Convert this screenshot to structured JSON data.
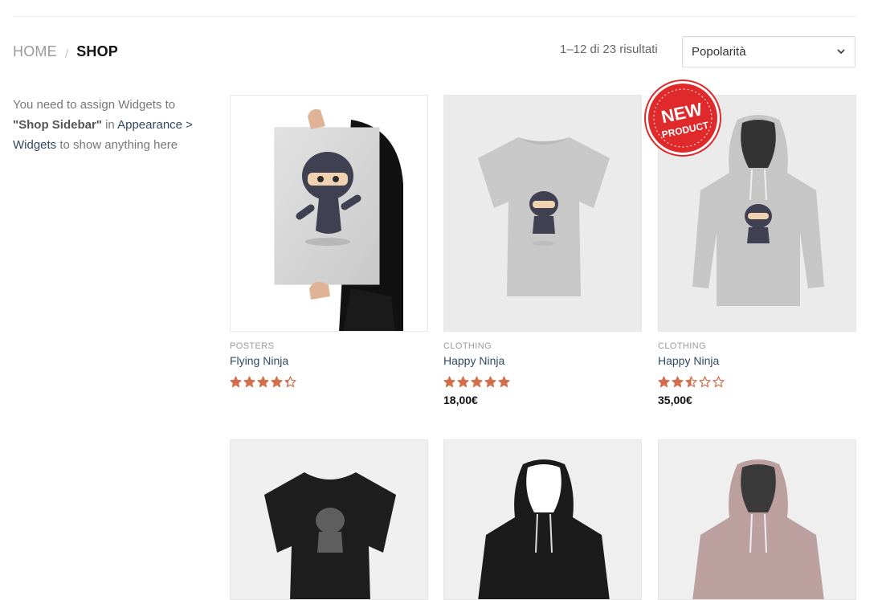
{
  "breadcrumb": {
    "home": "HOME",
    "separator": "/",
    "current": "SHOP"
  },
  "result_count": "1–12 di 23 risultati",
  "sort": {
    "selected": "Popolarità"
  },
  "sidebar": {
    "text1": "You need to assign Widgets to",
    "bold": "\"Shop Sidebar\"",
    "text2": "in",
    "link": "Appearance > Widgets",
    "text3": "to show anything here"
  },
  "products": [
    {
      "category": "POSTERS",
      "name": "Flying Ninja",
      "rating": 4.3,
      "price": ""
    },
    {
      "category": "CLOTHING",
      "name": "Happy Ninja",
      "rating": 5,
      "price": "18,00€"
    },
    {
      "category": "CLOTHING",
      "name": "Happy Ninja",
      "rating": 2.5,
      "price": "35,00€"
    }
  ],
  "badge": {
    "line1": "NEW",
    "line2": "PRODUCT"
  },
  "colors": {
    "star": "#d26e4b",
    "link": "#334862",
    "badge": "#e0292b"
  }
}
